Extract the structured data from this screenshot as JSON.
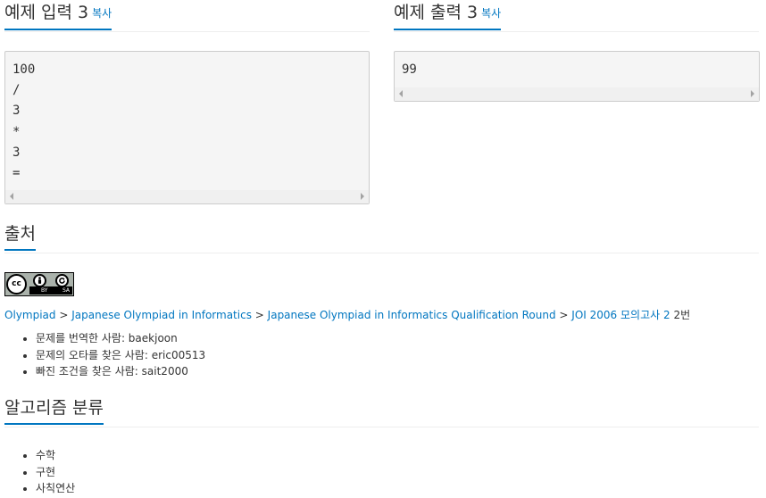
{
  "example_input": {
    "title": "예제 입력 3",
    "copy_label": "복사",
    "lines": [
      "100",
      "/",
      "3",
      "*",
      "3",
      "="
    ]
  },
  "example_output": {
    "title": "예제 출력 3",
    "copy_label": "복사",
    "lines": [
      "99"
    ]
  },
  "source": {
    "title": "출처",
    "license_badge": {
      "cc": "cc",
      "by": "BY",
      "sa": "SA"
    },
    "breadcrumb": {
      "items": [
        "Olympiad",
        "Japanese Olympiad in Informatics",
        "Japanese Olympiad in Informatics Qualification Round",
        "JOI 2006 모의고사 2"
      ],
      "separator": ">",
      "suffix": "2번"
    },
    "credits": [
      "문제를 번역한 사람: baekjoon",
      "문제의 오타를 찾은 사람: eric00513",
      "빠진 조건을 찾은 사람: sait2000"
    ]
  },
  "algorithm": {
    "title": "알고리즘 분류",
    "tags": [
      "수학",
      "구현",
      "사칙연산"
    ]
  }
}
